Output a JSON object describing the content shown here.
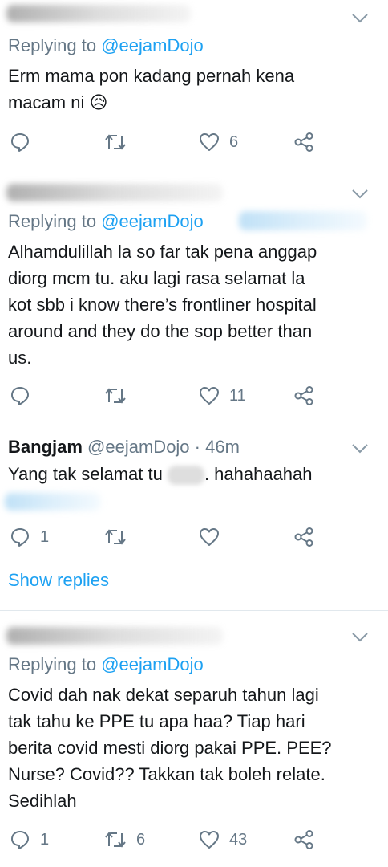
{
  "tweets": [
    {
      "reply_prefix": "Replying to",
      "reply_handle": "@eejamDojo",
      "text_lines": [
        "Erm mama pon kadang pernah kena",
        "macam ni"
      ],
      "emoji": "😥",
      "actions": {
        "reply_count": "",
        "retweet_count": "",
        "like_count": "6"
      }
    },
    {
      "reply_prefix": "Replying to",
      "reply_handle": "@eejamDojo",
      "text_lines": [
        "Alhamdulillah la so far tak pena anggap",
        "diorg mcm tu. aku lagi rasa selamat la",
        "kot sbb i know there’s frontliner hospital",
        "around and they do the sop better than",
        "us."
      ],
      "actions": {
        "reply_count": "",
        "retweet_count": "",
        "like_count": "11"
      }
    },
    {
      "author_name": "Bangjam",
      "author_handle": "@eejamDojo",
      "time": "· 46m",
      "text_before": "Yang tak selamat tu",
      "text_after": ". hahahaahah",
      "actions": {
        "reply_count": "1",
        "retweet_count": "",
        "like_count": ""
      },
      "show_replies": "Show replies"
    },
    {
      "reply_prefix": "Replying to",
      "reply_handle": "@eejamDojo",
      "text_lines": [
        "Covid dah nak dekat separuh tahun lagi",
        "tak tahu ke PPE tu apa haa? Tiap hari",
        "berita covid mesti diorg pakai PPE. PEE?",
        "Nurse? Covid?? Takkan tak boleh relate.",
        "Sedihlah"
      ],
      "actions": {
        "reply_count": "1",
        "retweet_count": "6",
        "like_count": "43"
      }
    }
  ],
  "icons": {
    "reply": "reply-icon",
    "retweet": "retweet-icon",
    "like": "heart-icon",
    "share": "share-icon",
    "menu": "chevron-down-icon"
  },
  "colors": {
    "text": "#14171a",
    "secondary": "#657786",
    "accent": "#1da1f2",
    "divider": "#e1e8ed"
  }
}
